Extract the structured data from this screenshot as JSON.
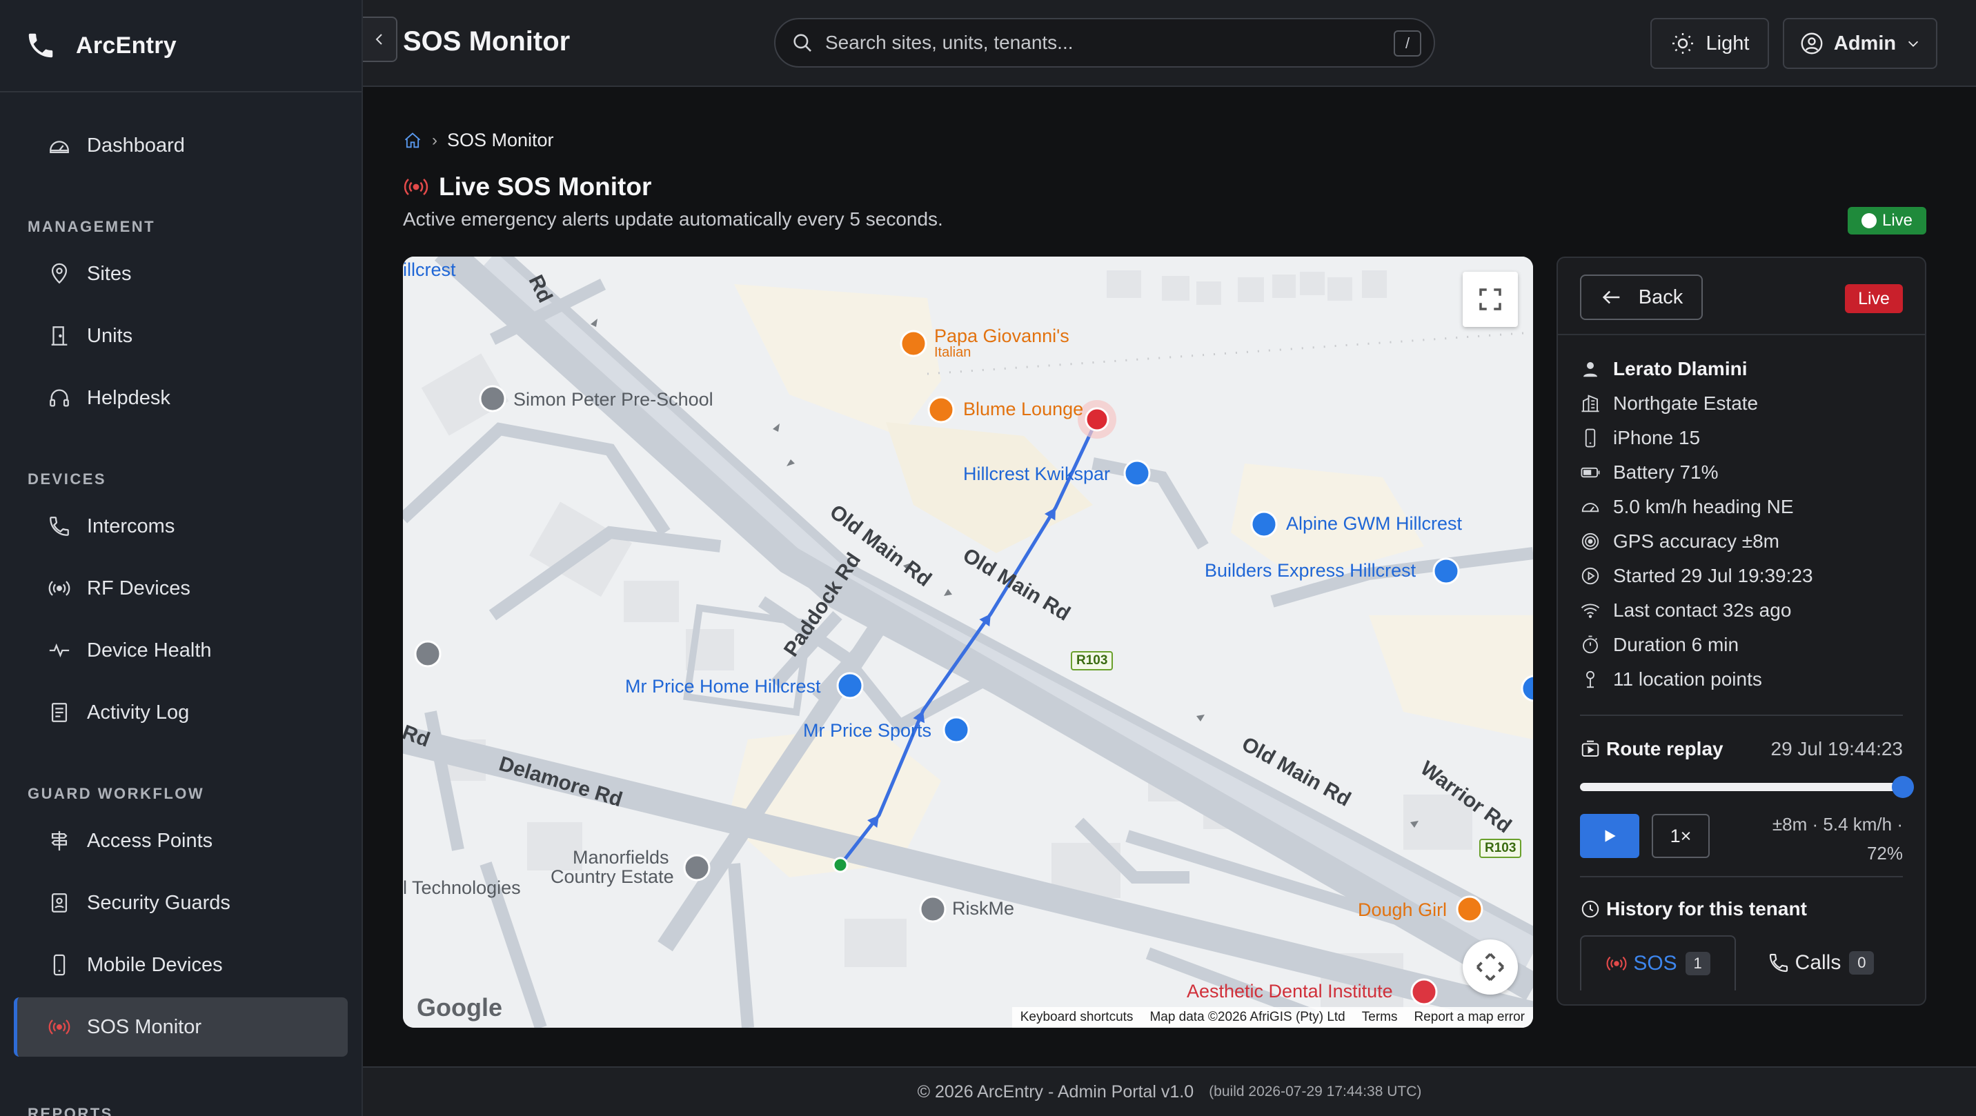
{
  "brand": {
    "name": "ArcEntry"
  },
  "sidebar": {
    "top": [
      {
        "label": "Dashboard",
        "icon": "gauge-icon"
      }
    ],
    "sections": [
      {
        "title": "MANAGEMENT",
        "items": [
          {
            "label": "Sites",
            "icon": "map-pin-icon"
          },
          {
            "label": "Units",
            "icon": "door-icon"
          },
          {
            "label": "Helpdesk",
            "icon": "headset-icon"
          }
        ]
      },
      {
        "title": "DEVICES",
        "items": [
          {
            "label": "Intercoms",
            "icon": "phone-icon"
          },
          {
            "label": "RF Devices",
            "icon": "broadcast-icon"
          },
          {
            "label": "Device Health",
            "icon": "pulse-icon"
          },
          {
            "label": "Activity Log",
            "icon": "log-icon"
          }
        ]
      },
      {
        "title": "GUARD WORKFLOW",
        "items": [
          {
            "label": "Access Points",
            "icon": "signpost-icon"
          },
          {
            "label": "Security Guards",
            "icon": "badge-icon"
          },
          {
            "label": "Mobile Devices",
            "icon": "mobile-icon"
          },
          {
            "label": "SOS Monitor",
            "icon": "broadcast-icon",
            "active": true
          }
        ]
      }
    ],
    "next_section": "REPORTS"
  },
  "header": {
    "title": "SOS Monitor",
    "search_placeholder": "Search sites, units, tenants...",
    "search_shortcut": "/",
    "theme_label": "Light",
    "user_label": "Admin"
  },
  "breadcrumb": {
    "current": "SOS Monitor"
  },
  "page": {
    "title": "Live SOS Monitor",
    "subtitle": "Active emergency alerts update automatically every 5 seconds.",
    "live_label": "Live"
  },
  "map": {
    "places": {
      "papa": "Papa Giovanni's",
      "papa_sub": "Italian",
      "blume": "Blume Lounge",
      "kwikspar": "Hillcrest Kwikspar",
      "alpine": "Alpine GWM Hillcrest",
      "builders": "Builders Express Hillcrest",
      "simon": "Simon Peter Pre-School",
      "mrprice_home": "Mr Price Home Hillcrest",
      "mrprice_sport": "Mr Price Sports",
      "manor1": "Manorfields",
      "manor2": "Country Estate",
      "tech": "l Technologies",
      "riskme": "RiskMe",
      "dough": "Dough Girl",
      "dental": "Aesthetic Dental Institute",
      "hillcrest": "illcrest"
    },
    "roads": {
      "old_main": "Old Main Rd",
      "paddock": "Paddock Rd",
      "delamore": "Delamore Rd",
      "warrior": "Warrior Rd",
      "rd_top": "Rd",
      "rd_left": "Rd",
      "r103": "R103"
    },
    "logo": "Google",
    "footer": [
      "Keyboard shortcuts",
      "Map data ©2026 AfriGIS (Pty) Ltd",
      "Terms",
      "Report a map error"
    ]
  },
  "panel": {
    "back_label": "Back",
    "live_badge": "Live",
    "info": [
      {
        "icon": "person-icon",
        "text": "Lerato Dlamini"
      },
      {
        "icon": "building-icon",
        "text": "Northgate Estate"
      },
      {
        "icon": "phone-device-icon",
        "text": "iPhone 15"
      },
      {
        "icon": "battery-icon",
        "text": "Battery 71%"
      },
      {
        "icon": "speedometer-icon",
        "text": "5.0 km/h heading NE"
      },
      {
        "icon": "target-icon",
        "text": "GPS accuracy ±8m"
      },
      {
        "icon": "play-circle-icon",
        "text": "Started 29 Jul 19:39:23"
      },
      {
        "icon": "wifi-icon",
        "text": "Last contact 32s ago"
      },
      {
        "icon": "stopwatch-icon",
        "text": "Duration 6 min"
      },
      {
        "icon": "pin-icon",
        "text": "11 location points"
      }
    ],
    "replay": {
      "title": "Route replay",
      "timestamp": "29 Jul 19:44:23",
      "progress": 1.0,
      "speed": "1×",
      "stats_line1": "±8m · 5.4 km/h ·",
      "stats_line2": "72%"
    },
    "history": {
      "title": "History for this tenant",
      "tabs": [
        {
          "label": "SOS",
          "count": "1"
        },
        {
          "label": "Calls",
          "count": "0"
        }
      ]
    }
  },
  "footer": {
    "copyright": "© 2026 ArcEntry - Admin Portal v1.0",
    "build": "(build 2026-07-29 17:44:38 UTC)"
  },
  "colors": {
    "accent": "#2f74e0",
    "danger": "#c9202b",
    "success": "#1f8a3b",
    "route": "#3a6fe0"
  }
}
